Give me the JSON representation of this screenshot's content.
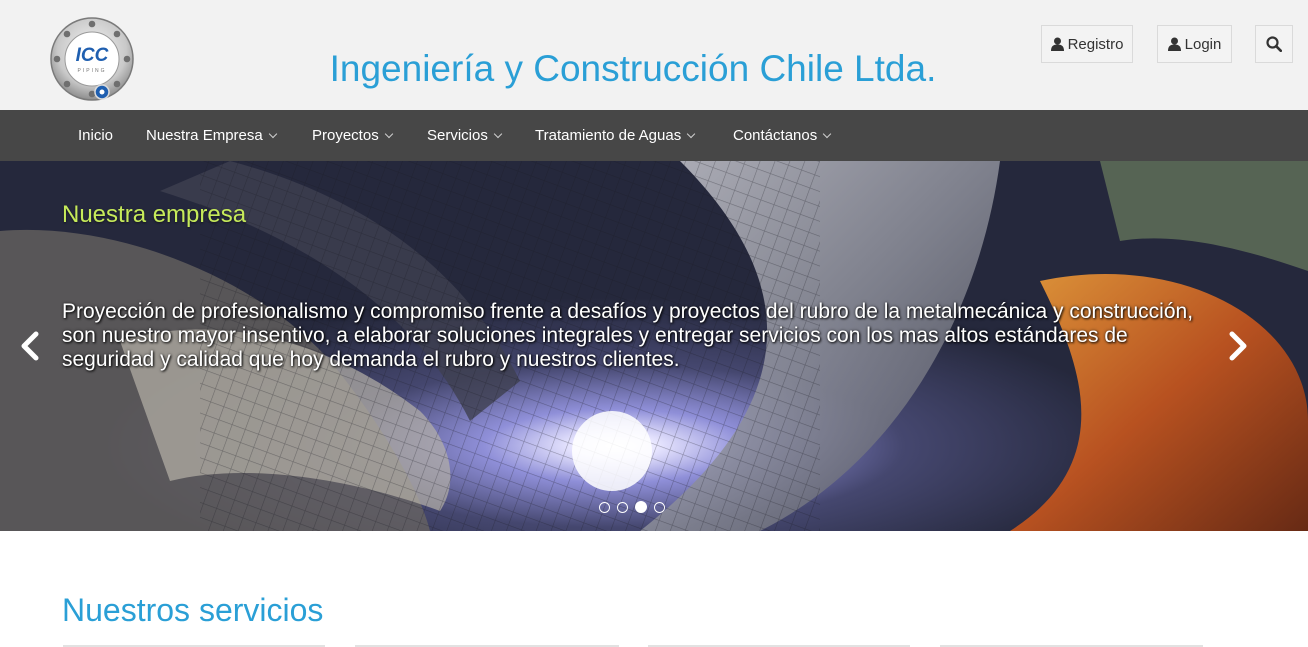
{
  "site": {
    "title": "Ingeniería y Construcción Chile Ltda.",
    "logo_text": "ICC",
    "logo_subtext": "PIPING"
  },
  "header_buttons": {
    "registro": "Registro",
    "login": "Login"
  },
  "nav": {
    "items": [
      {
        "label": "Inicio",
        "dropdown": false
      },
      {
        "label": "Nuestra Empresa",
        "dropdown": true
      },
      {
        "label": "Proyectos",
        "dropdown": true
      },
      {
        "label": "Servicios",
        "dropdown": true
      },
      {
        "label": "Tratamiento de Aguas",
        "dropdown": true
      },
      {
        "label": "Contáctanos",
        "dropdown": true
      }
    ]
  },
  "carousel": {
    "title": "Nuestra empresa",
    "text": "Proyección de profesionalismo y compromiso frente a desafíos y proyectos del rubro de la metalmecánica y construcción, son nuestro mayor insentivo, a elaborar soluciones integrales y entregar servicios con los mas altos estándares de seguridad y calidad que hoy demanda el rubro y nuestros clientes.",
    "slide_count": 4,
    "active_slide": 3
  },
  "services": {
    "heading": "Nuestros servicios"
  },
  "colors": {
    "brand": "#2a9fd6",
    "nav_bg": "#474747",
    "header_bg": "#f2f2f2",
    "slide_title": "#c6ea5a"
  }
}
